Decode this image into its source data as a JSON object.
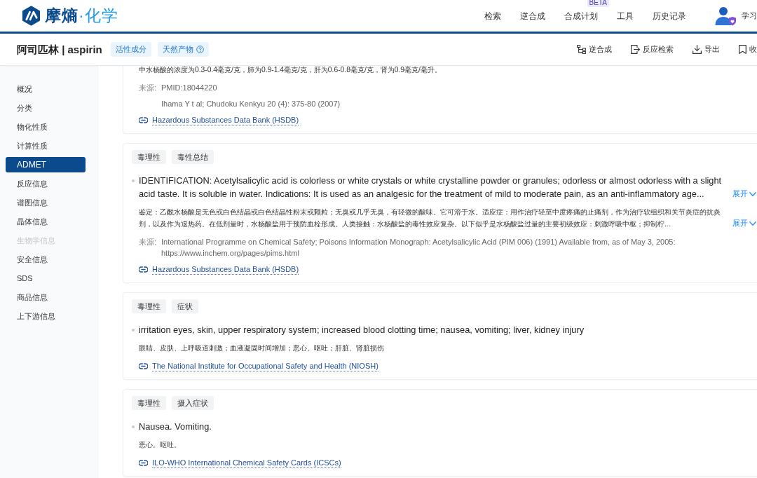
{
  "header": {
    "logo": {
      "name": "摩熵",
      "suffix": "·化学"
    },
    "nav": [
      {
        "label": "检索"
      },
      {
        "label": "逆合成"
      },
      {
        "label": "合成计划",
        "badge": "BETA"
      },
      {
        "label": "工具"
      },
      {
        "label": "历史记录"
      }
    ],
    "user": {
      "label": "学习"
    }
  },
  "compound_bar": {
    "title": "阿司匹林 | aspirin",
    "tags": [
      {
        "label": "活性成分",
        "info": false
      },
      {
        "label": "天然产物",
        "info": true
      }
    ],
    "actions": [
      {
        "label": "逆合成"
      },
      {
        "label": "反应检索"
      },
      {
        "label": "导出"
      },
      {
        "label": "收"
      }
    ]
  },
  "sidebar": {
    "items": [
      {
        "label": "概况",
        "selected": false,
        "disabled": false
      },
      {
        "label": "分类",
        "selected": false,
        "disabled": false
      },
      {
        "label": "物化性质",
        "selected": false,
        "disabled": false
      },
      {
        "label": "计算性质",
        "selected": false,
        "disabled": false
      },
      {
        "label": "ADMET",
        "selected": true,
        "disabled": false
      },
      {
        "label": "反应信息",
        "selected": false,
        "disabled": false
      },
      {
        "label": "谱图信息",
        "selected": false,
        "disabled": false
      },
      {
        "label": "晶体信息",
        "selected": false,
        "disabled": false
      },
      {
        "label": "生物学信息",
        "selected": false,
        "disabled": true
      },
      {
        "label": "安全信息",
        "selected": false,
        "disabled": false
      },
      {
        "label": "SDS",
        "selected": false,
        "disabled": false
      },
      {
        "label": "商品信息",
        "selected": false,
        "disabled": false
      },
      {
        "label": "上下游信息",
        "selected": false,
        "disabled": false
      }
    ]
  },
  "records": [
    {
      "translation": {
        "text": "中水杨酸的浓度为0.3-0.4毫克/克，肺为0.9-1.4毫克/克，肝为0.6-0.8毫克/克，肾为0.9毫克/毫升。"
      },
      "source": {
        "label": "来源:",
        "items": [
          "PMID:18044220",
          "Ihama Y t al; Chudoku Kenkyu 20 (4): 375-80 (2007)"
        ]
      },
      "link": "Hazardous Substances Data Bank (HSDB)"
    },
    {
      "tags": [
        "毒理性",
        "毒性总结"
      ],
      "summary": {
        "text": "IDENTIFICATION: Acetylsalicylic acid is colorless or white crystals or white crystalline powder or granules; odorless or almost odorless with a slight acid taste. It is soluble in water. Indications: It is used as an analgesic for the treatment of mild to moderate pain, as an anti-inflammatory age...",
        "expand": {
          "label": "展开",
          "expanded": false
        }
      },
      "translation": {
        "text": "鉴定：乙酰水杨酸是无色或白色结晶或白色结晶性粉末或颗粒；无臭或几乎无臭，有轻微的酸味。它可溶于水。适应症：用作治疗轻至中度疼痛的止痛剂，作为治疗软组织和关节炎症的抗炎剂，以及作为退热药。在低剂量时，水杨酸盐用于预防血栓形成。人类接触：水杨酸盐的毒性效应复杂。以下似乎是水杨酸盐过量的主要初级效应：刺激呼吸中枢；抑制柠...",
        "expand": {
          "label": "展开",
          "expanded": false
        }
      },
      "source": {
        "label": "来源:",
        "items": [
          "International Programme on Chemical Safety; Poisons Information Monograph: Acetylsalicylic Acid (PIM 006) (1991) Available from, as of May 3, 2005: https://www.inchem.org/pages/pims.html"
        ]
      },
      "link": "Hazardous Substances Data Bank (HSDB)"
    },
    {
      "tags": [
        "毒理性",
        "症状"
      ],
      "summary": {
        "text": "irritation eyes, skin, upper respiratory system; increased blood clotting time; nausea, vomiting; liver, kidney injury"
      },
      "translation": {
        "text": "眼睛、皮肤、上呼吸道刺激；血液凝固时间增加；恶心、呕吐；肝脏、肾脏损伤"
      },
      "link": "The National Institute for Occupational Safety and Health (NIOSH)"
    },
    {
      "tags": [
        "毒理性",
        "摄入症状"
      ],
      "summary": {
        "text": "Nausea. Vomiting."
      },
      "translation": {
        "text": "恶心。呕吐。"
      },
      "link": "ILO-WHO International Chemical Safety Cards (ICSCs)"
    }
  ]
}
